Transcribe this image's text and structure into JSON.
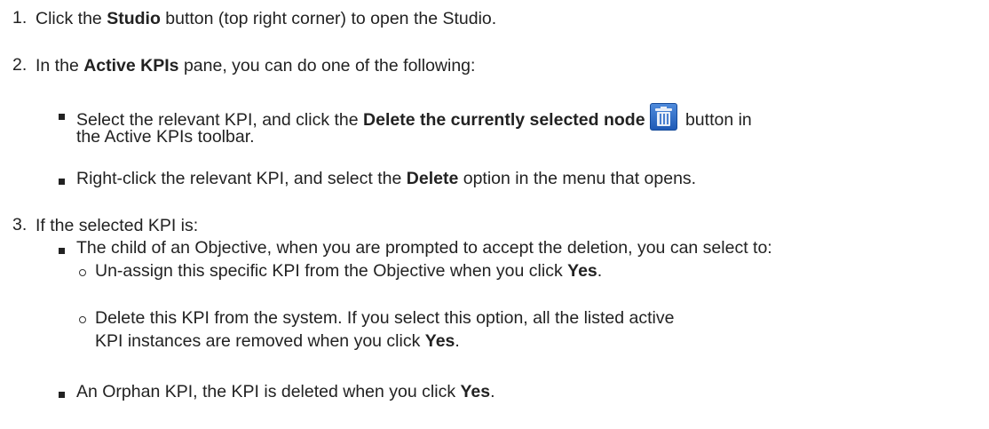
{
  "steps": {
    "s1": {
      "num": "1.",
      "pre": "Click the ",
      "b1": "Studio",
      "post": " button (top right corner) to open the Studio."
    },
    "s2": {
      "num": "2.",
      "pre": "In the ",
      "b1": "Active KPIs",
      "post": " pane, you can do one of the following:"
    },
    "s2a": {
      "pre": "Select the relevant KPI, and click the ",
      "b1": "Delete the currently selected node",
      "post": " button in",
      "cont": "the Active KPIs toolbar.",
      "icon": "trash-icon"
    },
    "s2b": {
      "pre": "Right-click the relevant KPI, and select the ",
      "b1": "Delete",
      "post": " option in the menu that opens."
    },
    "s3": {
      "num": "3.",
      "text": "If the selected KPI is:"
    },
    "s3a": {
      "text": "The child of an Objective, when you are prompted to accept the deletion, you can select to:"
    },
    "s3a1": {
      "pre": "Un-assign this specific KPI from the Objective when you click ",
      "b1": "Yes",
      "post": "."
    },
    "s3a2": {
      "l1": "Delete this KPI from the system. If you select this option, all the listed active",
      "pre": "KPI instances are removed when you click ",
      "b1": "Yes",
      "post": "."
    },
    "s3b": {
      "pre": "An Orphan KPI, the KPI is deleted when you click ",
      "b1": "Yes",
      "post": "."
    }
  },
  "colors": {
    "text": "#222222",
    "icon_button": "#2f6fd0"
  }
}
